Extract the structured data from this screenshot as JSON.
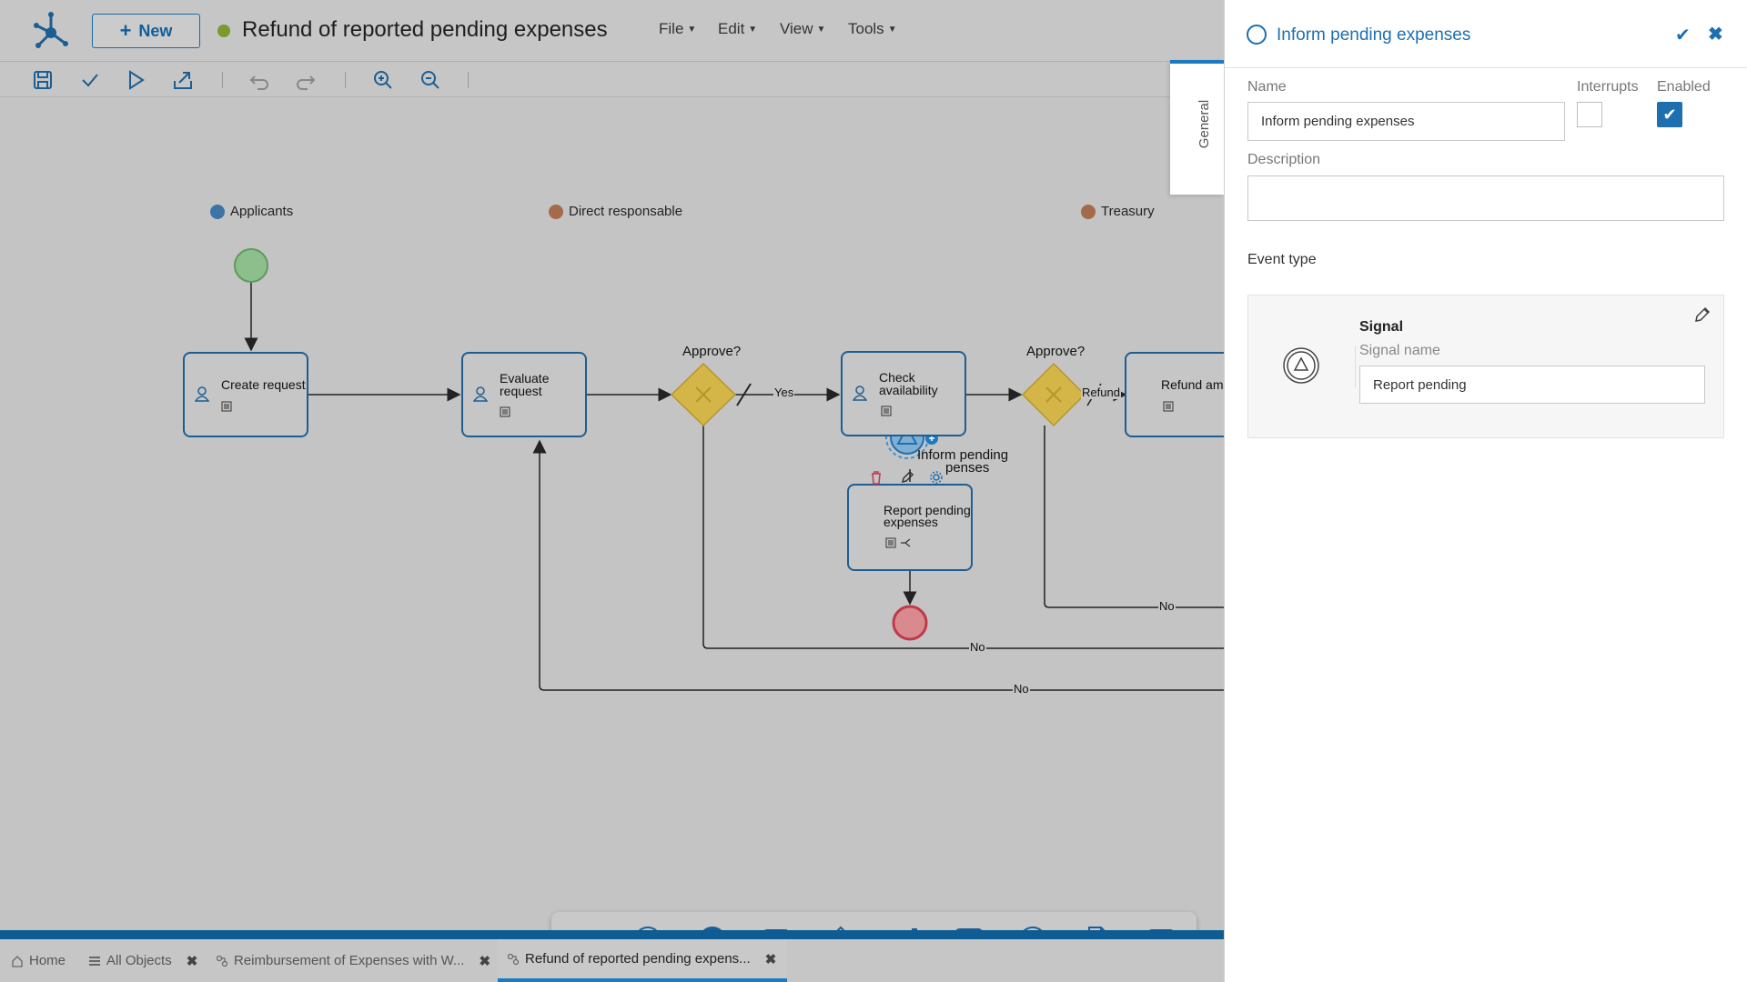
{
  "header": {
    "new_label": "New",
    "title": "Refund of reported pending expenses",
    "menus": [
      {
        "label": "File"
      },
      {
        "label": "Edit"
      },
      {
        "label": "View"
      },
      {
        "label": "Tools"
      }
    ]
  },
  "toolbar": {
    "icons": [
      "save-icon",
      "check-icon",
      "run-icon",
      "publish-icon",
      "undo-icon",
      "redo-icon",
      "zoom-in-icon",
      "zoom-out-icon"
    ]
  },
  "lanes": [
    "Applicants",
    "Direct responsable",
    "Treasury"
  ],
  "tasks": {
    "create_request": "Create request",
    "evaluate_request_1": "Evaluate",
    "evaluate_request_2": "request",
    "check_availability_1": "Check",
    "check_availability_2": "availability",
    "refund_amount": "Refund amo",
    "report_pending_1": "Report pending",
    "report_pending_2": "expenses"
  },
  "gateways": {
    "approve_1": "Approve?",
    "approve_2": "Approve?"
  },
  "flows": {
    "yes": "Yes",
    "refund": "Refund",
    "no_1": "No",
    "no_2": "No",
    "no_3": "No"
  },
  "boundary_event": {
    "label_1": "Inform pending",
    "label_2": "penses"
  },
  "bottom_tabs": [
    {
      "label": "Home",
      "icon": "home-icon"
    },
    {
      "label": "All Objects",
      "icon": "list-icon"
    },
    {
      "label": "Reimbursement of Expenses with W...",
      "icon": "process-icon"
    },
    {
      "label": "Refund of reported pending expens...",
      "icon": "process-icon"
    }
  ],
  "panel": {
    "title": "Inform pending expenses",
    "side_tab": "General",
    "name_label": "Name",
    "name_value": "Inform pending expenses",
    "interrupts_label": "Interrupts",
    "interrupts_checked": false,
    "enabled_label": "Enabled",
    "enabled_checked": true,
    "description_label": "Description",
    "description_value": "",
    "event_type_label": "Event type",
    "signal_title": "Signal",
    "signal_name_label": "Signal name",
    "signal_name_value": "Report pending"
  },
  "colors": {
    "accent": "#1d6fb0",
    "task_border": "#1d5e92",
    "start_event": "#8cbf8c",
    "end_event": "#d98a8f",
    "gateway": "#d4b548"
  }
}
